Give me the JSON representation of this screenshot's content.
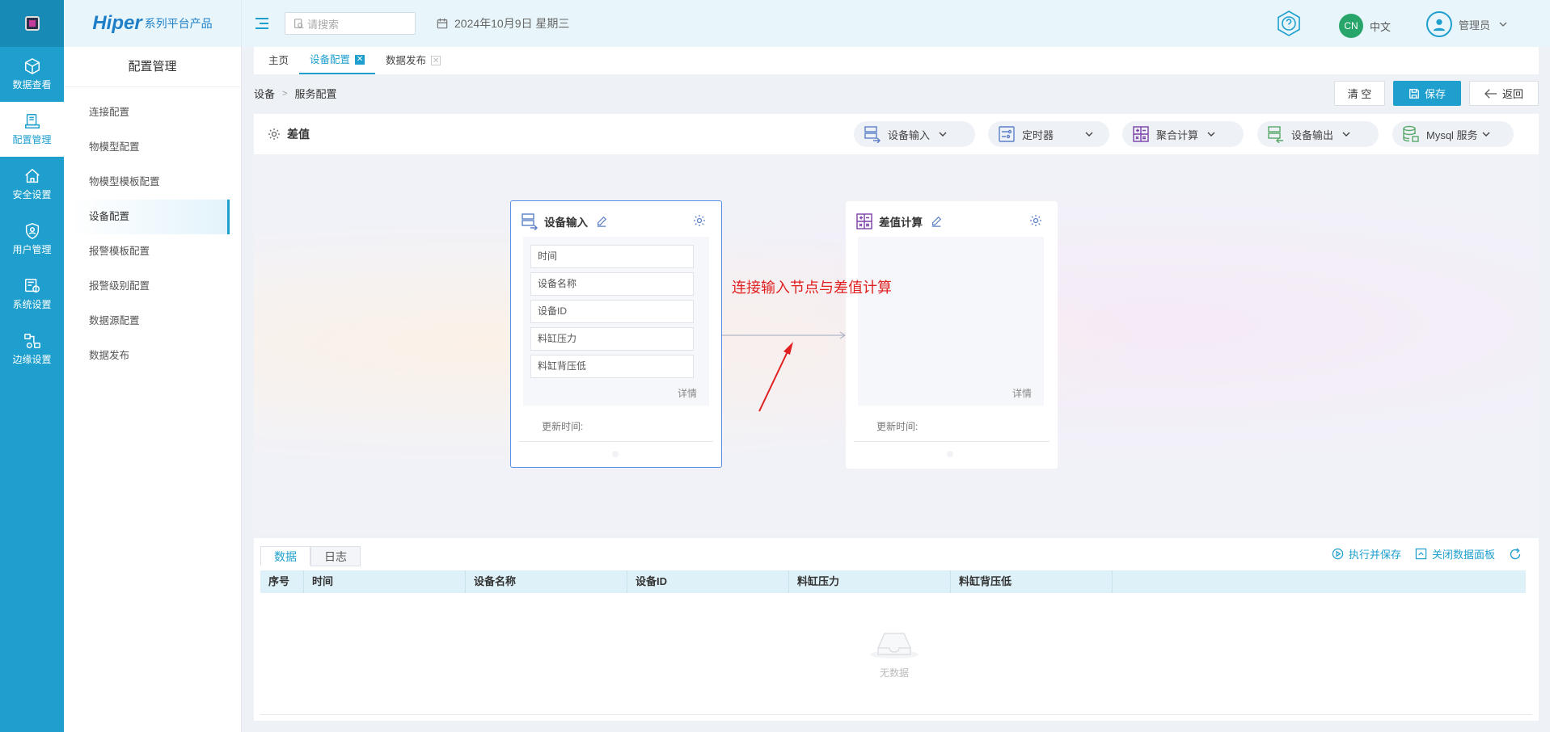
{
  "rail": {
    "items": [
      {
        "label": "数据查看",
        "icon": "cube-icon"
      },
      {
        "label": "配置管理",
        "icon": "config-doc-icon"
      },
      {
        "label": "安全设置",
        "icon": "home-shield-icon"
      },
      {
        "label": "用户管理",
        "icon": "user-shield-icon"
      },
      {
        "label": "系统设置",
        "icon": "system-gear-icon"
      },
      {
        "label": "边缘设置",
        "icon": "edge-network-icon"
      }
    ]
  },
  "brand": {
    "name": "Hiper",
    "suffix": "系列平台产品"
  },
  "sidebar": {
    "title": "配置管理",
    "items": [
      {
        "label": "连接配置"
      },
      {
        "label": "物模型配置"
      },
      {
        "label": "物模型模板配置"
      },
      {
        "label": "设备配置"
      },
      {
        "label": "报警模板配置"
      },
      {
        "label": "报警级别配置"
      },
      {
        "label": "数据源配置"
      },
      {
        "label": "数据发布"
      }
    ],
    "active_index": 3
  },
  "header": {
    "search_placeholder": "请搜索",
    "date": "2024年10月9日 星期三",
    "lang_badge": "CN",
    "lang_label": "中文",
    "user_name": "管理员"
  },
  "tabs": [
    {
      "label": "主页"
    },
    {
      "label": "设备配置"
    },
    {
      "label": "数据发布"
    }
  ],
  "breadcrumb": {
    "root": "设备",
    "current": "服务配置"
  },
  "actions": {
    "clear": "清 空",
    "save": "保存",
    "back": "返回"
  },
  "panel": {
    "title": "差值",
    "toolbar": [
      {
        "label": "设备输入"
      },
      {
        "label": "定时器"
      },
      {
        "label": "聚合计算"
      },
      {
        "label": "设备输出"
      },
      {
        "label": "Mysql 服务"
      }
    ]
  },
  "nodes": {
    "input": {
      "title": "设备输入",
      "fields": [
        "时间",
        "设备名称",
        "设备ID",
        "料缸压力",
        "料缸背压低"
      ],
      "detail": "详情",
      "updated": "更新时间:"
    },
    "calc": {
      "title": "差值计算",
      "detail": "详情",
      "updated": "更新时间:"
    }
  },
  "annotation": "连接输入节点与差值计算",
  "data_panel": {
    "tabs": [
      "数据",
      "日志"
    ],
    "actions": {
      "run_save": "执行并保存",
      "close_panel": "关闭数据面板"
    },
    "columns": [
      "序号",
      "时间",
      "设备名称",
      "设备ID",
      "料缸压力",
      "料缸背压低"
    ],
    "empty": "无数据"
  },
  "colors": {
    "primary": "#1e9fce",
    "annotation": "#e02020"
  }
}
